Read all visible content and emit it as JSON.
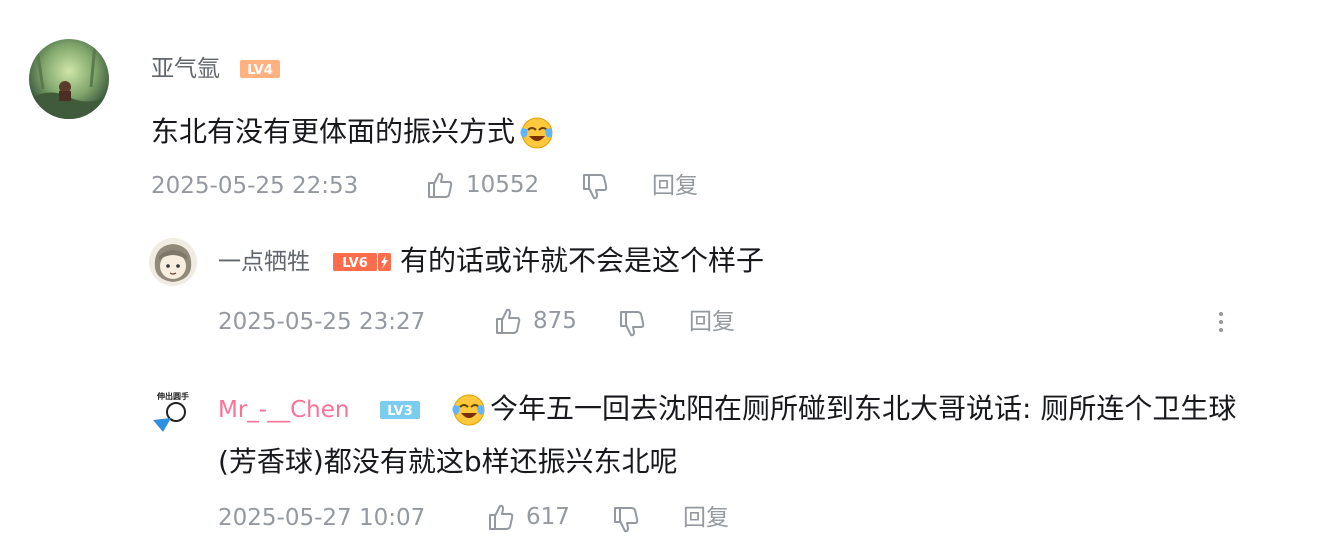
{
  "comments": [
    {
      "username": "亚气氩",
      "level": "LV4",
      "text": "东北有没有更体面的振兴方式",
      "emoji": "crying-laughing-emoji",
      "time": "2025-05-25 22:53",
      "likes": "10552",
      "reply_label": "回复",
      "replies": [
        {
          "username": "一点牺牲",
          "level": "LV6",
          "text": "有的话或许就不会是这个样子",
          "time": "2025-05-25 23:27",
          "likes": "875",
          "reply_label": "回复"
        },
        {
          "username": "Mr_-__Chen",
          "level": "LV3",
          "avatar_text": "伸出圆手",
          "emoji": "crying-laughing-emoji",
          "text_line1": "今年五一回去沈阳在厕所碰到东北大哥说话: 厕所连个卫生球",
          "text_line2": "(芳香球)都没有就这b样还振兴东北呢",
          "time": "2025-05-27 10:07",
          "likes": "617",
          "reply_label": "回复"
        }
      ]
    }
  ],
  "colors": {
    "username": "#61666d",
    "username_vip": "#fb7299",
    "meta": "#9499a0",
    "text": "#18191c",
    "lv4": "#ffb27f",
    "lv6": "#ff6c4c",
    "lv3": "#7bcdef"
  }
}
